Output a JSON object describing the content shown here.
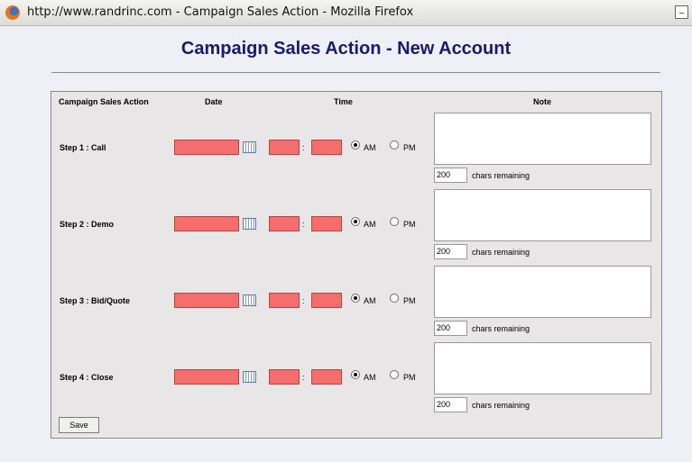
{
  "window": {
    "title": "http://www.randrinc.com - Campaign Sales Action - Mozilla Firefox",
    "minimize_label": "_"
  },
  "page": {
    "heading": "Campaign Sales Action - New Account"
  },
  "table": {
    "headers": {
      "action": "Campaign Sales Action",
      "date": "Date",
      "time": "Time",
      "note": "Note"
    },
    "steps": [
      {
        "label": "Step 1 : Call",
        "am_label": "AM",
        "pm_label": "PM",
        "am_checked": true,
        "chars_remaining": "200",
        "chars_label": "chars remaining"
      },
      {
        "label": "Step 2 : Demo",
        "am_label": "AM",
        "pm_label": "PM",
        "am_checked": true,
        "chars_remaining": "200",
        "chars_label": "chars remaining"
      },
      {
        "label": "Step 3 : Bid/Quote",
        "am_label": "AM",
        "pm_label": "PM",
        "am_checked": true,
        "chars_remaining": "200",
        "chars_label": "chars remaining"
      },
      {
        "label": "Step 4 : Close",
        "am_label": "AM",
        "pm_label": "PM",
        "am_checked": true,
        "chars_remaining": "200",
        "chars_label": "chars remaining"
      }
    ],
    "time_separator": ":"
  },
  "buttons": {
    "save": "Save"
  },
  "colors": {
    "required_field": "#f56d6d",
    "heading": "#1a1a6e",
    "panel_bg": "#e8e6e6"
  }
}
